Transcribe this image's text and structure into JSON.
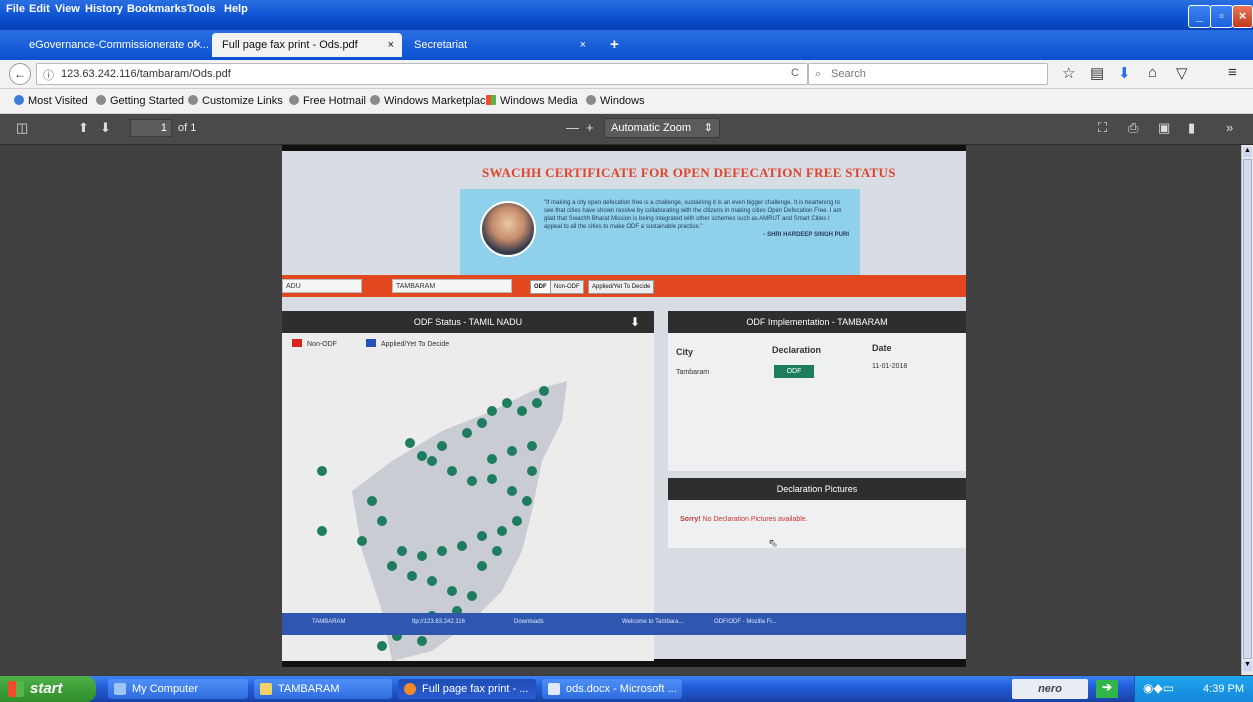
{
  "menu": [
    "File",
    "Edit",
    "View",
    "History",
    "Bookmarks",
    "Tools",
    "Help"
  ],
  "tabs": [
    {
      "label": "eGovernance-Commissionerate of ...",
      "close": "×"
    },
    {
      "label": "Full page fax print - Ods.pdf",
      "close": "×"
    },
    {
      "label": "Secretariat",
      "close": "×"
    }
  ],
  "new_tab": "+",
  "nav": {
    "url": "123.63.242.116/tambaram/Ods.pdf",
    "search_placeholder": "Search",
    "info_glyph": "ⓘ",
    "reload_glyph": "C"
  },
  "bookmarks": [
    "Most Visited",
    "Getting Started",
    "Customize Links",
    "Free Hotmail",
    "Windows Marketplace",
    "Windows Media",
    "Windows"
  ],
  "pdf": {
    "page": "1",
    "of": "of 1",
    "zoom": "Automatic Zoom",
    "minus": "—",
    "plus": "+"
  },
  "doc": {
    "title": "SWACHH CERTIFICATE FOR OPEN DEFECATION FREE STATUS",
    "quote": "\"If making a city open defecation free is a challenge, sustaining it is an even bigger challenge. It is heartening to see that cities have shown resolve by collaborating with the citizens in making cities Open Defecation Free. I am glad that Swachh Bharat Mission is being integrated with other schemes such as AMRUT and Smart Cities I appeal to all the cities to make ODF a sustainable practice.\"",
    "quote_author": "- SHRI HARDEEP SINGH PURI",
    "state_input": "ADU",
    "city_input": "TAMBARAM",
    "seg": [
      "ODF",
      "Non-ODF",
      "Applied/Yet To Decide"
    ],
    "odf_status_header": "ODF Status - TAMIL NADU",
    "legend": [
      "Non-ODF",
      "Applied/Yet To Decide"
    ],
    "impl_header": "ODF Implementation - TAMBARAM",
    "columns": [
      "City",
      "Declaration",
      "Date"
    ],
    "row": {
      "city": "Tambaram",
      "declaration": "ODF",
      "date": "11-01-2018"
    },
    "pictures_header": "Declaration Pictures",
    "sorry": "Sorry!",
    "no_pictures": "No Declaration Pictures available.",
    "inner_taskbar": [
      "TAMBARAM",
      "ftp://123.63.242.116",
      "Downloads",
      "Welcome to Tambara...",
      "ODF/ODF - Mozilla Fi..."
    ]
  },
  "taskbar": {
    "start": "start",
    "tasks": [
      "My Computer",
      "TAMBARAM",
      "Full page fax print - ...",
      "ods.docx - Microsoft ..."
    ],
    "nero": "nero",
    "clock": "4:39 PM"
  },
  "colors": {
    "xp_blue": "#245edb",
    "accent_red": "#e2481f",
    "odf_green": "#1e7d5f",
    "title_red": "#e0422b"
  }
}
